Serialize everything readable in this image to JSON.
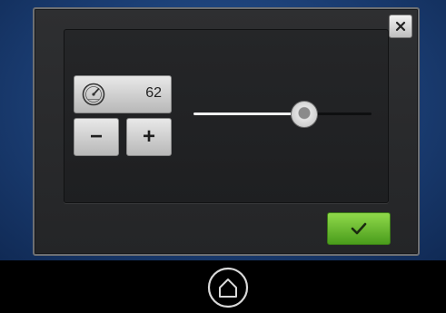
{
  "dialog": {
    "close_icon": "close-icon",
    "speed": {
      "icon": "speedometer-icon",
      "value": "62"
    },
    "decrease": {
      "label": "−",
      "icon": "minus-icon"
    },
    "increase": {
      "label": "+",
      "icon": "plus-icon"
    },
    "slider": {
      "level_fraction": 0.62
    },
    "confirm": {
      "icon": "checkmark-icon",
      "color": "#6cc235"
    }
  },
  "navigation": {
    "home_icon": "home-icon"
  },
  "colors": {
    "background_blue": "#1b3e74",
    "dialog": "#2a2b2d",
    "confirm_green": "#6cc235"
  }
}
